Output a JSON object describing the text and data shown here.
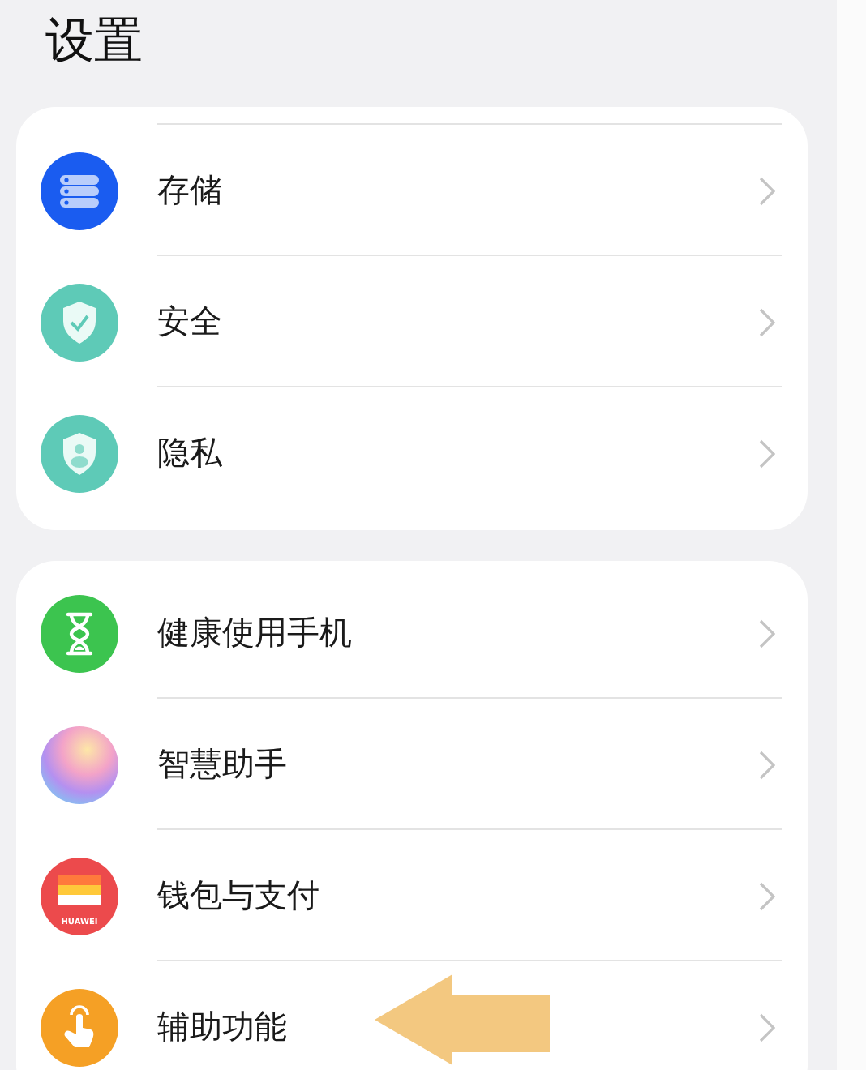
{
  "title": "设置",
  "cards": [
    {
      "continued": true,
      "items": [
        {
          "label": "存储",
          "kind": "storage"
        },
        {
          "label": "安全",
          "kind": "security"
        },
        {
          "label": "隐私",
          "kind": "privacy"
        }
      ]
    },
    {
      "continued": false,
      "items": [
        {
          "label": "健康使用手机",
          "kind": "hourglass"
        },
        {
          "label": "智慧助手",
          "kind": "assistant"
        },
        {
          "label": "钱包与支付",
          "kind": "wallet",
          "icon_text": "HUAWEI"
        },
        {
          "label": "辅助功能",
          "kind": "accessibility",
          "pointer": true
        }
      ]
    }
  ]
}
